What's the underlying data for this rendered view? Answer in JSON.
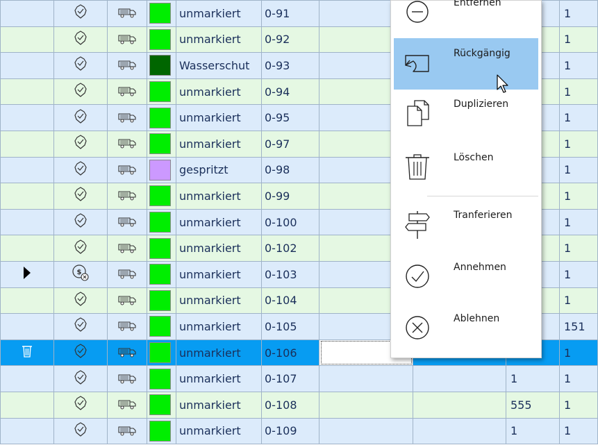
{
  "rows": [
    {
      "label": "unmarkiert",
      "code": "0-91",
      "n1": "",
      "n2": "1",
      "swatch": "#00ee00",
      "status": "check",
      "pointer": "",
      "style": "blue"
    },
    {
      "label": "unmarkiert",
      "code": "0-92",
      "n1": "",
      "n2": "1",
      "swatch": "#00ee00",
      "status": "check",
      "pointer": "",
      "style": "green"
    },
    {
      "label": "Wasserschut",
      "code": "0-93",
      "n1": "",
      "n2": "1",
      "swatch": "#006600",
      "status": "check",
      "pointer": "",
      "style": "blue"
    },
    {
      "label": "unmarkiert",
      "code": "0-94",
      "n1": "",
      "n2": "1",
      "swatch": "#00ee00",
      "status": "check",
      "pointer": "",
      "style": "green"
    },
    {
      "label": "unmarkiert",
      "code": "0-95",
      "n1": "",
      "n2": "1",
      "swatch": "#00ee00",
      "status": "check",
      "pointer": "",
      "style": "blue"
    },
    {
      "label": "unmarkiert",
      "code": "0-97",
      "n1": "",
      "n2": "1",
      "swatch": "#00ee00",
      "status": "check",
      "pointer": "",
      "style": "green"
    },
    {
      "label": "gespritzt",
      "code": "0-98",
      "n1": "",
      "n2": "1",
      "swatch": "#cc99ff",
      "status": "check",
      "pointer": "",
      "style": "blue"
    },
    {
      "label": "unmarkiert",
      "code": "0-99",
      "n1": "",
      "n2": "1",
      "swatch": "#00ee00",
      "status": "check",
      "pointer": "",
      "style": "green"
    },
    {
      "label": "unmarkiert",
      "code": "0-100",
      "n1": "",
      "n2": "1",
      "swatch": "#00ee00",
      "status": "check",
      "pointer": "",
      "style": "blue"
    },
    {
      "label": "unmarkiert",
      "code": "0-102",
      "n1": "",
      "n2": "1",
      "swatch": "#00ee00",
      "status": "check",
      "pointer": "",
      "style": "green"
    },
    {
      "label": "unmarkiert",
      "code": "0-103",
      "n1": "",
      "n2": "1",
      "swatch": "#00ee00",
      "status": "money",
      "pointer": "arrow",
      "style": "blue"
    },
    {
      "label": "unmarkiert",
      "code": "0-104",
      "n1": "",
      "n2": "1",
      "swatch": "#00ee00",
      "status": "check",
      "pointer": "",
      "style": "green"
    },
    {
      "label": "unmarkiert",
      "code": "0-105",
      "n1": "",
      "n2": "151",
      "swatch": "#00ee00",
      "status": "check",
      "pointer": "",
      "style": "blue"
    },
    {
      "label": "unmarkiert",
      "code": "0-106",
      "n1": "",
      "n2": "1",
      "swatch": "#00ee00",
      "status": "check",
      "pointer": "trash",
      "style": "sel"
    },
    {
      "label": "unmarkiert",
      "code": "0-107",
      "n1": "1",
      "n2": "1",
      "swatch": "#00ee00",
      "status": "check",
      "pointer": "",
      "style": "blue"
    },
    {
      "label": "unmarkiert",
      "code": "0-108",
      "n1": "555",
      "n2": "1",
      "swatch": "#00ee00",
      "status": "check",
      "pointer": "",
      "style": "green"
    },
    {
      "label": "unmarkiert",
      "code": "0-109",
      "n1": "1",
      "n2": "1",
      "swatch": "#00ee00",
      "status": "check",
      "pointer": "",
      "style": "blue"
    }
  ],
  "menu": {
    "highlighted_index": 1,
    "items": [
      {
        "label": "Entfernen",
        "icon": "minus-circle-icon"
      },
      {
        "label": "Rückgängig",
        "icon": "undo-icon"
      },
      {
        "label": "Duplizieren",
        "icon": "duplicate-icon"
      },
      {
        "label": "Löschen",
        "icon": "trash-icon"
      },
      {
        "label": "Tranferieren",
        "icon": "signpost-icon"
      },
      {
        "label": "Annehmen",
        "icon": "accept-check-icon"
      },
      {
        "label": "Ablehnen",
        "icon": "reject-x-icon"
      }
    ]
  },
  "colors": {
    "row_blue": "#dcebfb",
    "row_green": "#e5f8e3",
    "selected_row": "#079cf2",
    "menu_highlight": "#99c9f1",
    "grid_line": "#9fb3c8"
  }
}
